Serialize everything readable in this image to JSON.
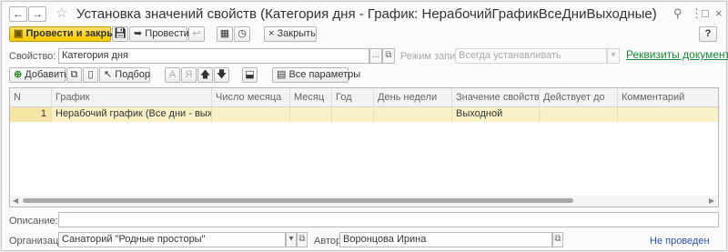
{
  "window": {
    "title": "Установка значений свойств (Категория дня - График: НерабочийГрафикВсеДниВыходные)",
    "nav_back": "←",
    "nav_forward": "→",
    "star": "☆",
    "title_icons": [
      "link-icon",
      "more-icon",
      "maximize-icon",
      "close-icon"
    ]
  },
  "toolbar": {
    "post_and_close": "Провести и закрыть",
    "post": "Провести",
    "close": "Закрыть",
    "help": "?"
  },
  "form": {
    "property_label": "Свойство:",
    "property_value": "Категория дня",
    "write_mode_label": "Режим записи:",
    "write_mode_value": "Всегда устанавливать",
    "requisites_link": "Реквизиты документа"
  },
  "table_toolbar": {
    "add": "Добавить",
    "select": "Подбор",
    "all_params": "Все параметры",
    "letter_a": "А",
    "letter_ya": "Я"
  },
  "table": {
    "columns": [
      "N",
      "График",
      "Число месяца",
      "Месяц",
      "Год",
      "День недели",
      "Значение свойства",
      "Действует до",
      "Комментарий"
    ],
    "rows": [
      {
        "n": "1",
        "schedule": "Нерабочий график (Все дни - выходные)",
        "day": "",
        "month": "",
        "year": "",
        "weekday": "",
        "value": "Выходной",
        "valid_to": "",
        "comment": ""
      }
    ]
  },
  "footer": {
    "description_label": "Описание:",
    "description_value": "",
    "org_label": "Организация:",
    "org_value": "Санаторий \"Родные просторы\"",
    "author_label": "Автор:",
    "author_value": "Воронцова Ирина",
    "status": "Не проведен"
  },
  "colors": {
    "primary_button": "#f5c800",
    "selected_row": "#fbf1c8",
    "link": "#1a8a3a",
    "status": "#2b4fb5"
  }
}
